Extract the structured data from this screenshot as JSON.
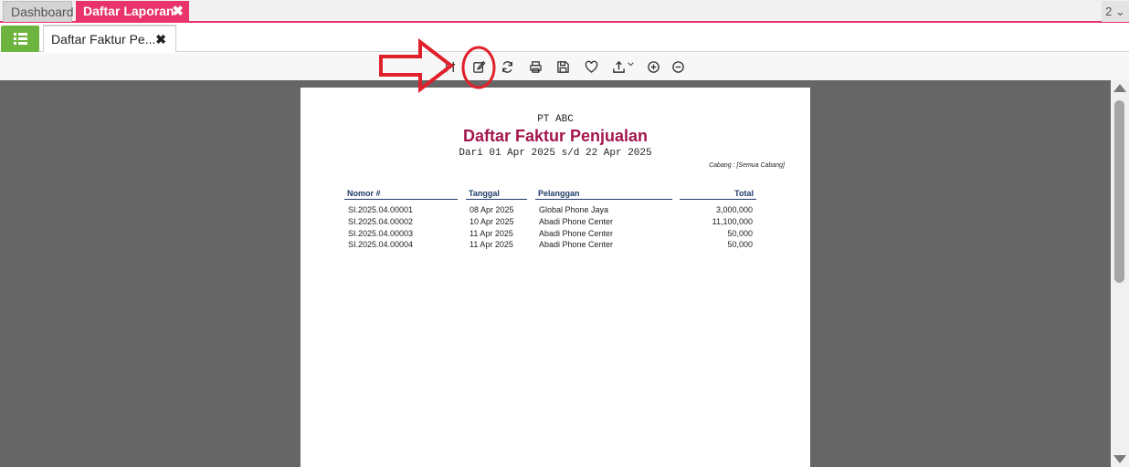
{
  "tabs": {
    "dashboard": "Dashboard",
    "active": "Daftar Laporan",
    "close": "✖",
    "counter": "2 ⌄"
  },
  "subtab": {
    "label": "Daftar Faktur Pe...",
    "close": "✖"
  },
  "report": {
    "company": "PT ABC",
    "title": "Daftar Faktur Penjualan",
    "period": "Dari 01 Apr 2025 s/d 22 Apr 2025",
    "branch": "Cabang : [Semua Cabang]",
    "headers": [
      "Nomor #",
      "Tanggal",
      "Pelanggan",
      "Total"
    ],
    "rows": [
      [
        "SI.2025.04.00001",
        "08 Apr 2025",
        "Global Phone Jaya",
        "3,000,000"
      ],
      [
        "SI.2025.04.00002",
        "10 Apr 2025",
        "Abadi Phone Center",
        "11,100,000"
      ],
      [
        "SI.2025.04.00003",
        "11 Apr 2025",
        "Abadi Phone Center",
        "50,000"
      ],
      [
        "SI.2025.04.00004",
        "11 Apr 2025",
        "Abadi Phone Center",
        "50,000"
      ]
    ]
  },
  "colors": {
    "accent": "#e8336b",
    "menu": "#6db33f",
    "title": "#a3164d",
    "header": "#1f3a68",
    "annotation": "#e0202a"
  }
}
